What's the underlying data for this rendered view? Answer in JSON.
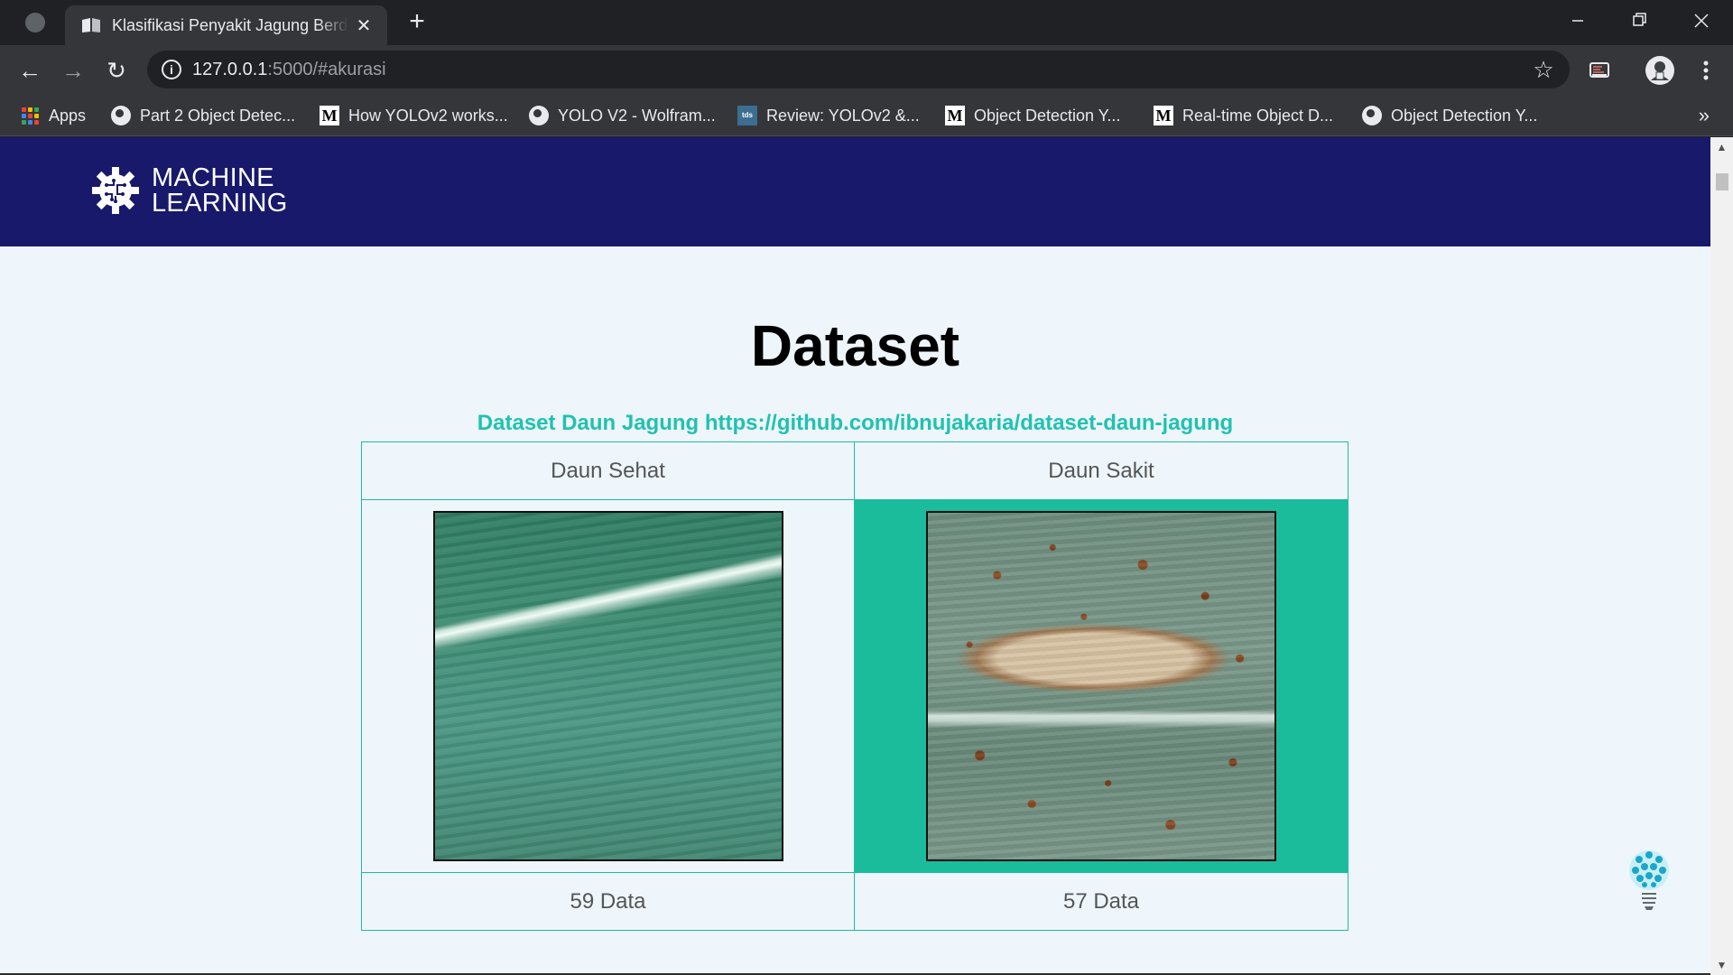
{
  "browser": {
    "tab_title": "Klasifikasi Penyakit Jagung Berdasarkan Citra Daun",
    "tab_close": "✕",
    "new_tab": "+",
    "url_host": "127.0.0.1",
    "url_rest": ":5000/#akurasi",
    "star": "☆",
    "back": "←",
    "forward": "→",
    "reload": "↻",
    "info": "i"
  },
  "bookmarks": {
    "apps": "Apps",
    "items": [
      {
        "label": "Part 2 Object Detec...",
        "icon": "globe-icon"
      },
      {
        "label": "How YOLOv2 works...",
        "icon": "medium-icon"
      },
      {
        "label": "YOLO V2 - Wolfram...",
        "icon": "globe-icon"
      },
      {
        "label": "Review: YOLOv2 &...",
        "icon": "tds-icon"
      },
      {
        "label": "Object Detection Y...",
        "icon": "medium-icon"
      },
      {
        "label": "Real-time Object D...",
        "icon": "medium-icon"
      },
      {
        "label": "Object Detection Y...",
        "icon": "globe-icon"
      }
    ],
    "more": "»",
    "medium_letter": "M",
    "tds_letters": "tds"
  },
  "site": {
    "logo_line1": "MACHINE",
    "logo_line2": "LEARNING",
    "title": "Dataset",
    "caption": "Dataset Daun Jagung https://github.com/ibnujakaria/dataset-daun-jagung",
    "table": {
      "headers": [
        "Daun Sehat",
        "Daun Sakit"
      ],
      "counts": [
        "59 Data",
        "57 Data"
      ]
    }
  },
  "scrollbar": {
    "up": "▲",
    "down": "▼"
  },
  "colors": {
    "header_bg": "#18196b",
    "accent": "#20c2b0",
    "highlight_cell": "#1abc9c",
    "page_bg": "#eef6fb"
  }
}
